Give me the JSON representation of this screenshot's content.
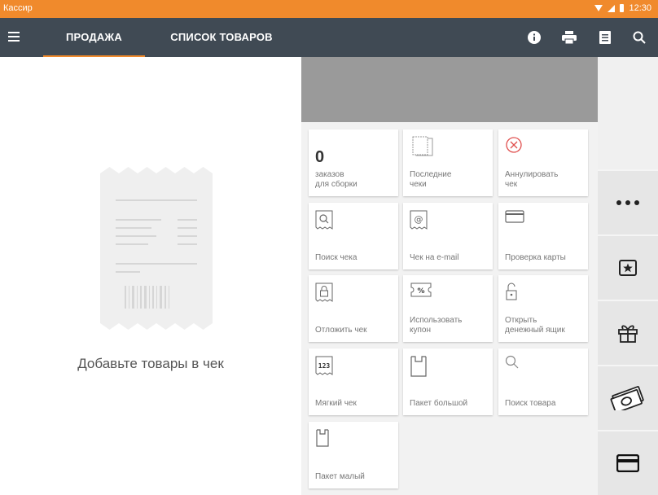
{
  "status_bar": {
    "app_name": "Кассир",
    "time": "12:30"
  },
  "toolbar": {
    "tabs": [
      {
        "label": "ПРОДАЖА",
        "active": true
      },
      {
        "label": "СПИСОК ТОВАРОВ",
        "active": false
      }
    ],
    "icons": [
      "menu-icon",
      "info-icon",
      "printer-icon",
      "document-icon",
      "search-icon"
    ],
    "accent_color": "#f08a2c",
    "bar_color": "#404a54"
  },
  "left_panel": {
    "empty_text": "Добавьте товары в чек"
  },
  "tiles": [
    {
      "count": "0",
      "label": "заказов\nдля сборки",
      "icon": "none"
    },
    {
      "label": "Последние\nчеки",
      "icon": "stacked-receipts-icon"
    },
    {
      "label": "Аннулировать\nчек",
      "icon": "cancel-circle-icon"
    },
    {
      "label": "Поиск чека",
      "icon": "receipt-search-icon"
    },
    {
      "label": "Чек на e-mail",
      "icon": "receipt-email-icon"
    },
    {
      "label": "Проверка карты",
      "icon": "card-icon"
    },
    {
      "label": "Отложить чек",
      "icon": "receipt-lock-icon"
    },
    {
      "label": "Использовать\nкупон",
      "icon": "coupon-icon"
    },
    {
      "label": "Открыть\nденежный ящик",
      "icon": "unlock-icon"
    },
    {
      "label": "Мягкий чек",
      "icon": "receipt-123-icon"
    },
    {
      "label": "Пакет большой",
      "icon": "bag-large-icon"
    },
    {
      "label": "Поиск товара",
      "icon": "search-icon"
    },
    {
      "label": "Пакет малый",
      "icon": "bag-small-icon"
    }
  ],
  "right_rail": [
    "more-icon",
    "star-box-icon",
    "gift-icon",
    "cash-icon",
    "card-icon"
  ]
}
